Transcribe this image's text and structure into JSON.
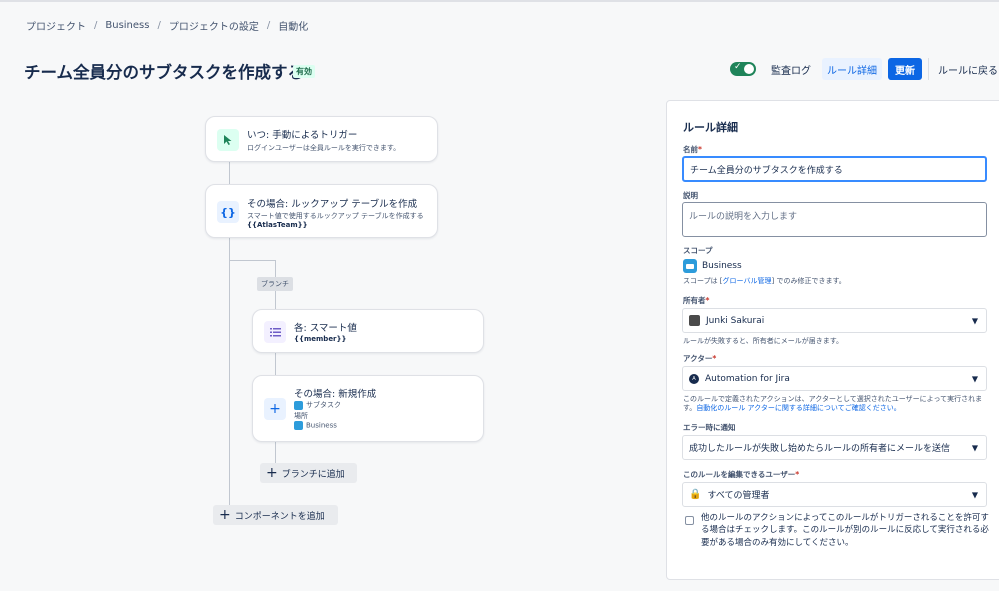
{
  "breadcrumb": {
    "items": [
      "プロジェクト",
      "Business",
      "プロジェクトの設定",
      "自動化"
    ],
    "separator": "/"
  },
  "header": {
    "title": "チーム全員分のサブタスクを作成する",
    "status": "有効",
    "toggle_on": true,
    "audit_log": "監査ログ",
    "rule_details": "ルール詳細",
    "update": "更新",
    "back_to_rules": "ルールに戻る"
  },
  "flow": {
    "trigger": {
      "title": "いつ: 手動によるトリガー",
      "sub": "ログインユーザーは全員ルールを実行できます。",
      "icon": "cursor-click-icon"
    },
    "lookup": {
      "title": "その場合: ルックアップ テーブルを作成",
      "sub": "スマート値で使用するルックアップ テーブルを作成する",
      "sub2": "{{AtlasTeam}}",
      "icon": "braces-icon"
    },
    "branch_tag": "ブランチ",
    "foreach": {
      "title": "各: スマート値",
      "sub": "{{member}}",
      "icon": "list-icon"
    },
    "create": {
      "title": "その場合: 新規作成",
      "issue_type": "サブタスク",
      "location_label": "場所",
      "location": "Business",
      "icon": "plus-icon"
    },
    "add_to_branch": "ブランチに追加",
    "add_component": "コンポーネントを追加"
  },
  "panel": {
    "title": "ルール詳細",
    "name_label": "名前",
    "name_value": "チーム全員分のサブタスクを作成する",
    "desc_label": "説明",
    "desc_placeholder": "ルールの説明を入力します",
    "scope_label": "スコープ",
    "scope_value": "Business",
    "scope_help_pre": "スコープは [",
    "scope_help_link": "グローバル管理",
    "scope_help_post": "] でのみ修正できます。",
    "owner_label": "所有者",
    "owner_value": "Junki Sakurai",
    "owner_help": "ルールが失敗すると、所有者にメールが届きます。",
    "actor_label": "アクター",
    "actor_value": "Automation for Jira",
    "actor_help": "このルールで定義されたアクションは、アクターとして選択されたユーザーによって実行されます。",
    "actor_help_link": "自動化のルール アクターに関する詳細についてご確認ください。",
    "notify_label": "エラー時に通知",
    "notify_value": "成功したルールが失敗し始めたらルールの所有者にメールを送信",
    "editors_label": "このルールを編集できるユーザー",
    "editors_value": "すべての管理者",
    "checkbox_text": "他のルールのアクションによってこのルールがトリガーされることを許可する場合はチェックします。このルールが別のルールに反応して実行される必要がある場合のみ有効にしてください。",
    "required_mark": "*"
  },
  "colors": {
    "accent": "#0c66e4",
    "toggle": "#1f845a",
    "status_bg": "#dcfff1",
    "status_text": "#216e4e"
  }
}
